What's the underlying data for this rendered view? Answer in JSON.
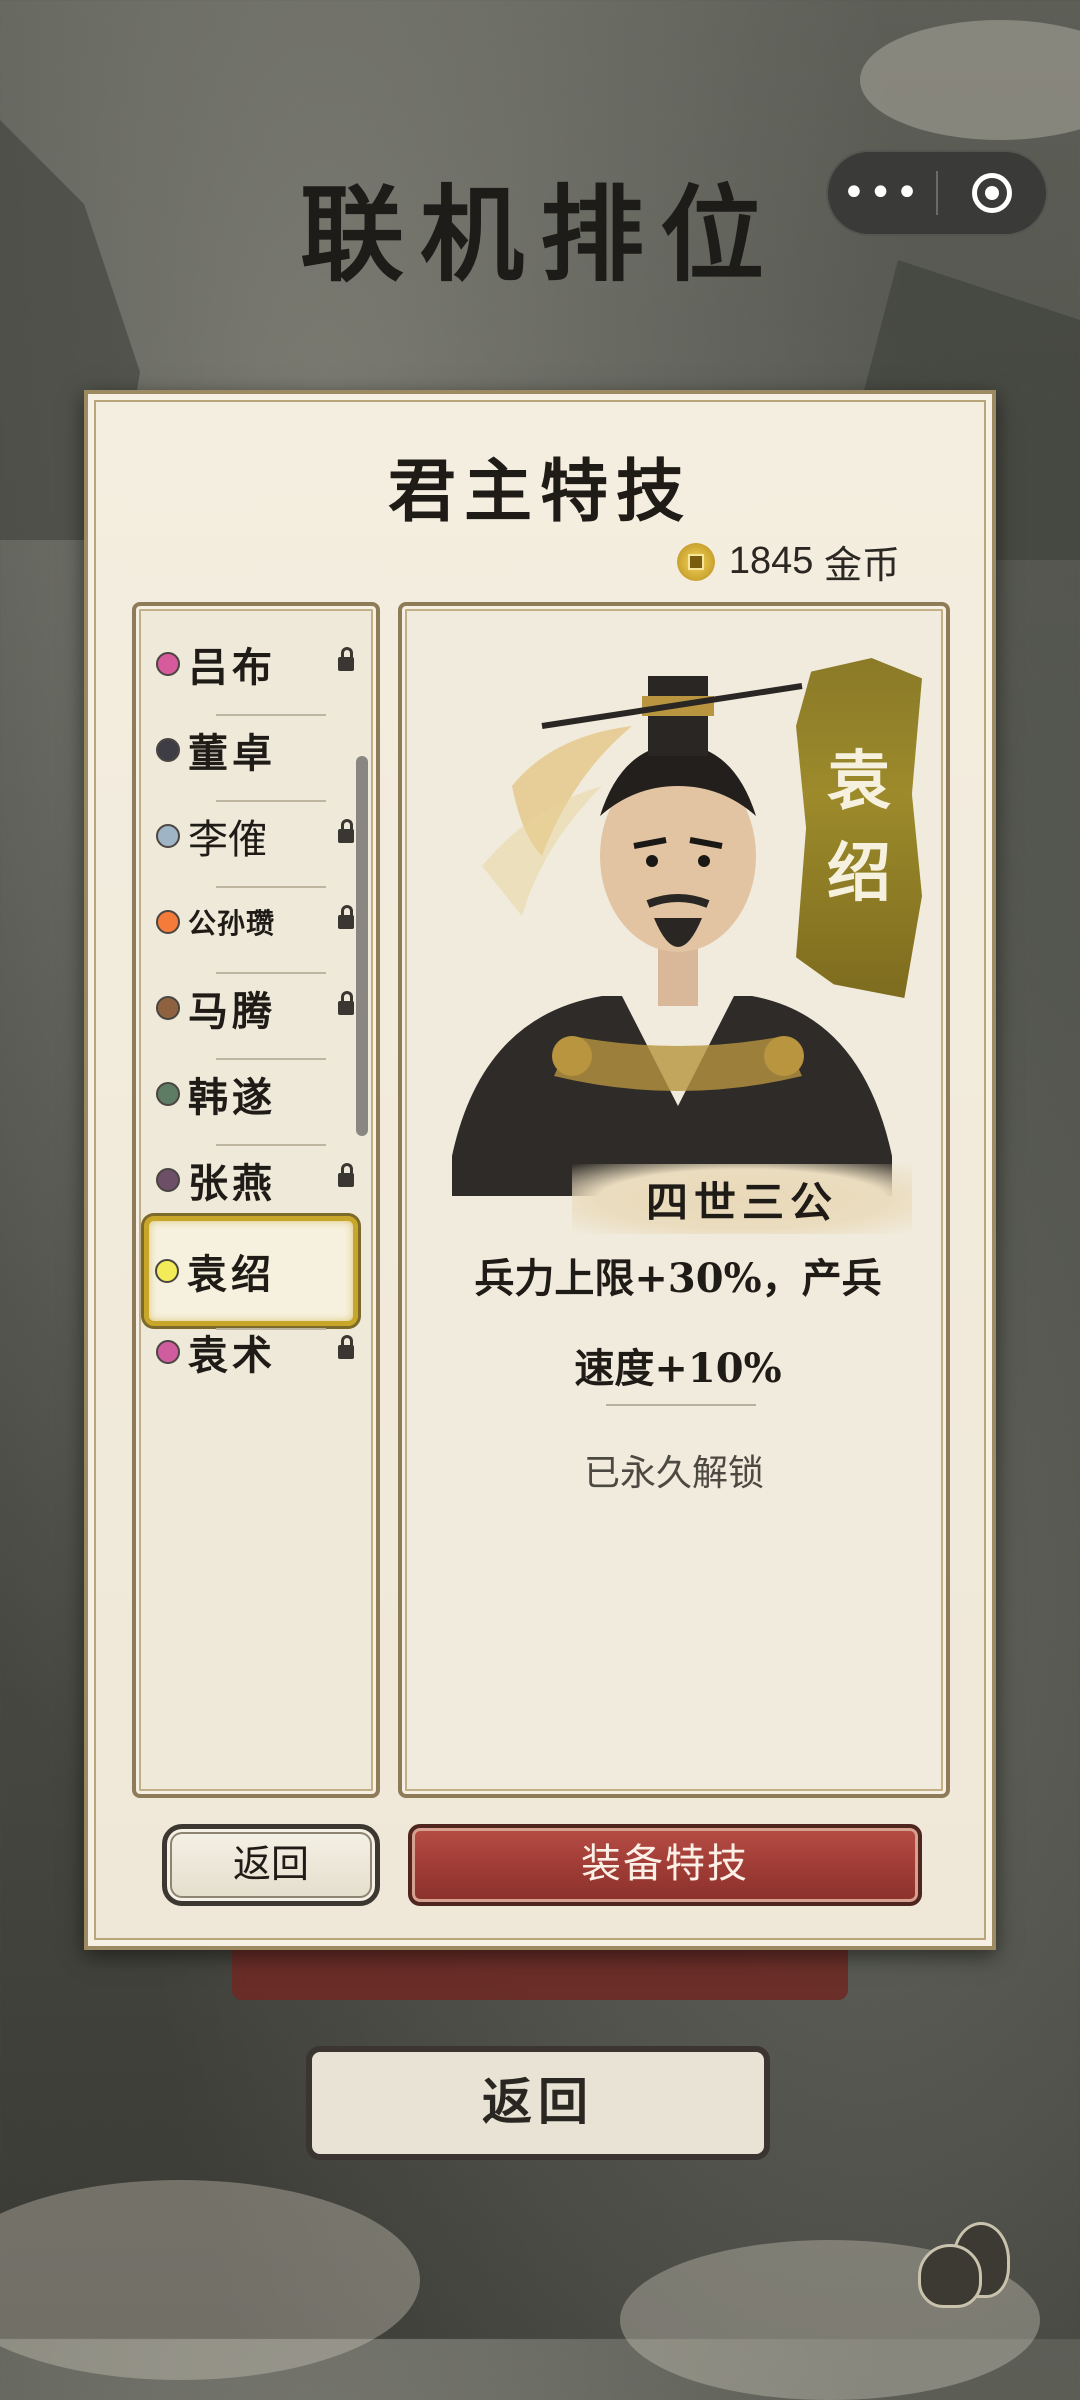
{
  "page_title": "联机排位",
  "top_capsule": {
    "more_icon": "more-dots-icon",
    "close_icon": "target-circle-icon"
  },
  "panel": {
    "title": "君主特技",
    "coins": {
      "amount": "1845",
      "unit": "金币",
      "icon": "coin-icon"
    },
    "lords": [
      {
        "name": "吕布",
        "dot_color": "#d65a9c",
        "locked": true
      },
      {
        "name": "董卓",
        "dot_color": "#3e3d45",
        "locked": false
      },
      {
        "name": "李傕",
        "dot_color": "#9fb4c4",
        "locked": true
      },
      {
        "name": "公孙瓒",
        "dot_color": "#f47b3a",
        "locked": true
      },
      {
        "name": "马腾",
        "dot_color": "#8e6241",
        "locked": true
      },
      {
        "name": "韩遂",
        "dot_color": "#5e7b63",
        "locked": false
      },
      {
        "name": "张燕",
        "dot_color": "#6d4f68",
        "locked": true
      },
      {
        "name": "袁绍",
        "dot_color": "#f3ec58",
        "locked": false,
        "selected": true
      },
      {
        "name": "袁术",
        "dot_color": "#d05ca0",
        "locked": true
      }
    ],
    "detail": {
      "lord_name": "袁绍",
      "lord_name_chars": [
        "袁",
        "绍"
      ],
      "skill_name": "四世三公",
      "description_line1": "兵力上限+30%，产兵",
      "description_line2": "速度+10%",
      "status": "已永久解锁"
    },
    "buttons": {
      "back": "返回",
      "equip": "装备特技"
    }
  },
  "background_return_label": "返回",
  "colors": {
    "accent_red": "#9d3a34",
    "gold_border": "#c8a62a",
    "paper": "#f1ebdd"
  }
}
